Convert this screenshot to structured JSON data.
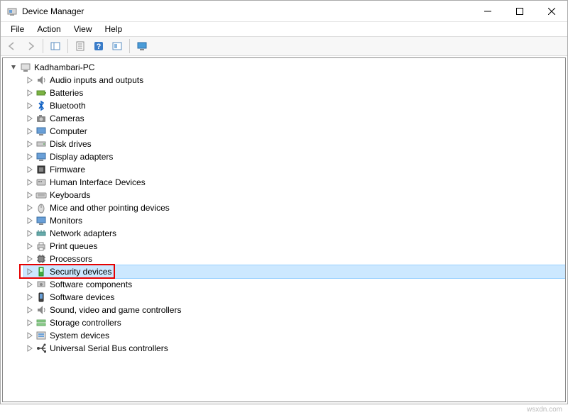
{
  "window": {
    "title": "Device Manager"
  },
  "menubar": {
    "items": [
      "File",
      "Action",
      "View",
      "Help"
    ]
  },
  "tree": {
    "root": "Kadhambari-PC",
    "items": [
      "Audio inputs and outputs",
      "Batteries",
      "Bluetooth",
      "Cameras",
      "Computer",
      "Disk drives",
      "Display adapters",
      "Firmware",
      "Human Interface Devices",
      "Keyboards",
      "Mice and other pointing devices",
      "Monitors",
      "Network adapters",
      "Print queues",
      "Processors",
      "Security devices",
      "Software components",
      "Software devices",
      "Sound, video and game controllers",
      "Storage controllers",
      "System devices",
      "Universal Serial Bus controllers"
    ],
    "selected_index": 15
  },
  "watermark": "wsxdn.com"
}
